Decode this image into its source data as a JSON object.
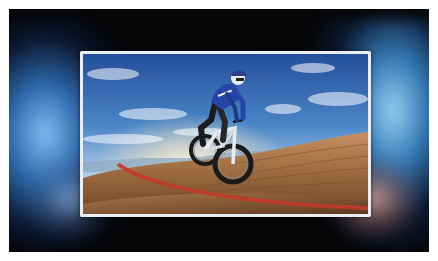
{
  "image": {
    "subject": "mountain-biker-on-tv-with-ambient-backlight",
    "colors": {
      "page_background": "#ffffff",
      "ambient_background": "#050608",
      "ambient_glow": "#5aaaf0",
      "tv_bezel": "#e9eef3",
      "sky_top": "#2a5fae",
      "sky_bottom": "#cfe3f3",
      "rock": "#b07a4a",
      "red_trail": "#c23a2a",
      "rider_jersey": "#2546a8"
    }
  }
}
